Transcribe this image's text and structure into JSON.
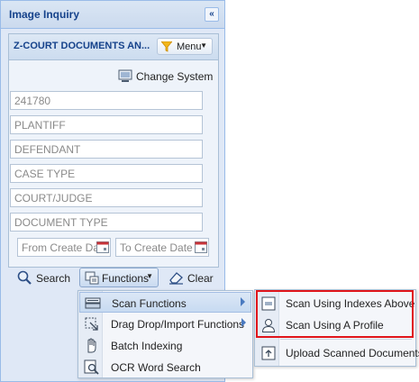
{
  "panel": {
    "title": "Image Inquiry",
    "collapse_glyph": "«"
  },
  "section": {
    "title": "Z-COURT DOCUMENTS AN...",
    "menu_label": "Menu"
  },
  "change_system_label": "Change System",
  "fields": {
    "case_number": "241780",
    "plaintiff": "PLANTIFF",
    "defendant": "DEFENDANT",
    "case_type": "CASE TYPE",
    "court_judge": "COURT/JUDGE",
    "document_type": "DOCUMENT TYPE",
    "from_create_date": "From Create Da",
    "to_create_date": "To Create Date"
  },
  "toolbar": {
    "search_label": "Search",
    "functions_label": "Functions",
    "clear_label": "Clear"
  },
  "functions_menu": {
    "items": [
      {
        "label": "Scan Functions",
        "icon": "scanner-icon"
      },
      {
        "label": "Drag Drop/Import Functions",
        "icon": "drag-drop-icon"
      },
      {
        "label": "Batch Indexing",
        "icon": "hand-icon"
      },
      {
        "label": "OCR Word Search",
        "icon": "ocr-search-icon"
      }
    ]
  },
  "scan_submenu": {
    "items": [
      {
        "label": "Scan Using Indexes Above",
        "icon": "index-scan-icon"
      },
      {
        "label": "Scan Using A Profile",
        "icon": "profile-icon"
      },
      {
        "label": "Upload Scanned Documents",
        "icon": "upload-icon"
      }
    ]
  },
  "colors": {
    "accent": "#15428b",
    "panel_bg": "#dfe8f6",
    "highlight_border": "#e0151b"
  }
}
